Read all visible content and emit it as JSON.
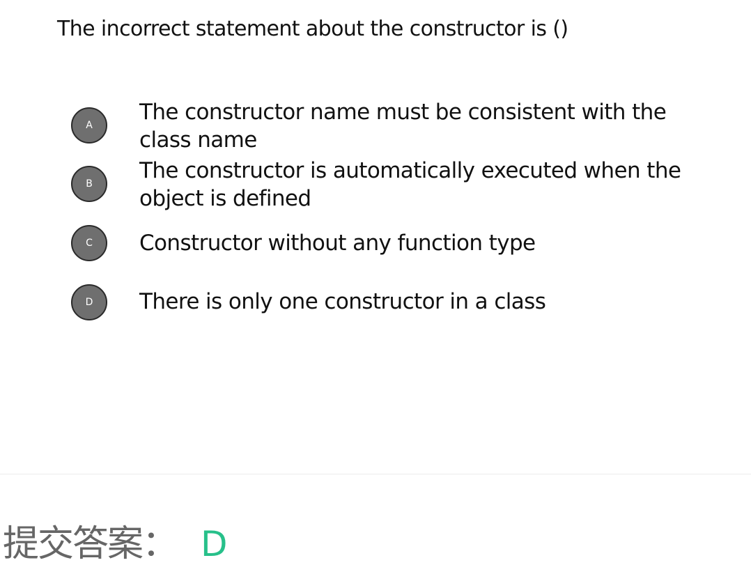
{
  "question": {
    "text": "The incorrect statement about the constructor is ()"
  },
  "options": [
    {
      "letter": "A",
      "text": "The constructor name must be consistent with the class name"
    },
    {
      "letter": "B",
      "text": "The constructor is automatically executed when the object is defined"
    },
    {
      "letter": "C",
      "text": "Constructor without any function type"
    },
    {
      "letter": "D",
      "text": "There is only one constructor in a class"
    }
  ],
  "answer": {
    "label": "提交答案：",
    "value": "D",
    "value_color": "#27c08a"
  },
  "colors": {
    "badge_fill": "#6f6f6f",
    "badge_border": "#2a2a2a",
    "text": "#111111",
    "answer_label": "#666666"
  }
}
